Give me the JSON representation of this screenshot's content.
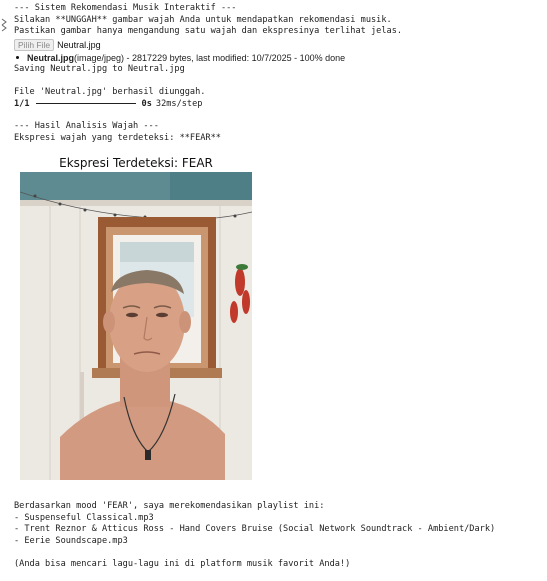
{
  "header_line": "--- Sistem Rekomendasi Musik Interaktif ---",
  "instruction_1": "Silakan **UNGGAH** gambar wajah Anda untuk mendapatkan rekomendasi musik.",
  "instruction_2": "Pastikan gambar hanya mengandung satu wajah dan ekspresinya terlihat jelas.",
  "upload": {
    "button_label": "Pilih File",
    "chosen_file": "Neutral.jpg"
  },
  "file_info": {
    "name": "Neutral.jpg",
    "details": "(image/jpeg) - 2817229 bytes, last modified: 10/7/2025 - 100% done"
  },
  "saving_line": "Saving Neutral.jpg to Neutral.jpg",
  "uploaded_line": "File 'Neutral.jpg' berhasil diunggah.",
  "progress": {
    "step": "1/1",
    "status": "0s",
    "rate": "32ms/step",
    "fraction": 1.0
  },
  "analysis_header": "--- Hasil Analisis Wajah ---",
  "detected_line": "Ekspresi wajah yang terdeteksi: **FEAR**",
  "figure_title": "Ekspresi Terdeteksi: FEAR",
  "recommendation_intro": "Berdasarkan mood 'FEAR', saya merekomendasikan playlist ini:",
  "playlist": [
    "- Suspenseful Classical.mp3",
    "- Trent Reznor & Atticus Ross - Hand Covers Bruise (Social Network Soundtrack - Ambient/Dark)",
    "- Eerie Soundscape.mp3"
  ],
  "footer_note": "(Anda bisa mencari lagu-lagu ini di platform musik favorit Anda!)",
  "colors": {
    "text": "#212121",
    "wall": "#ece8e2",
    "window_frame": "#9a5a34",
    "sky": "#5e8a92"
  }
}
